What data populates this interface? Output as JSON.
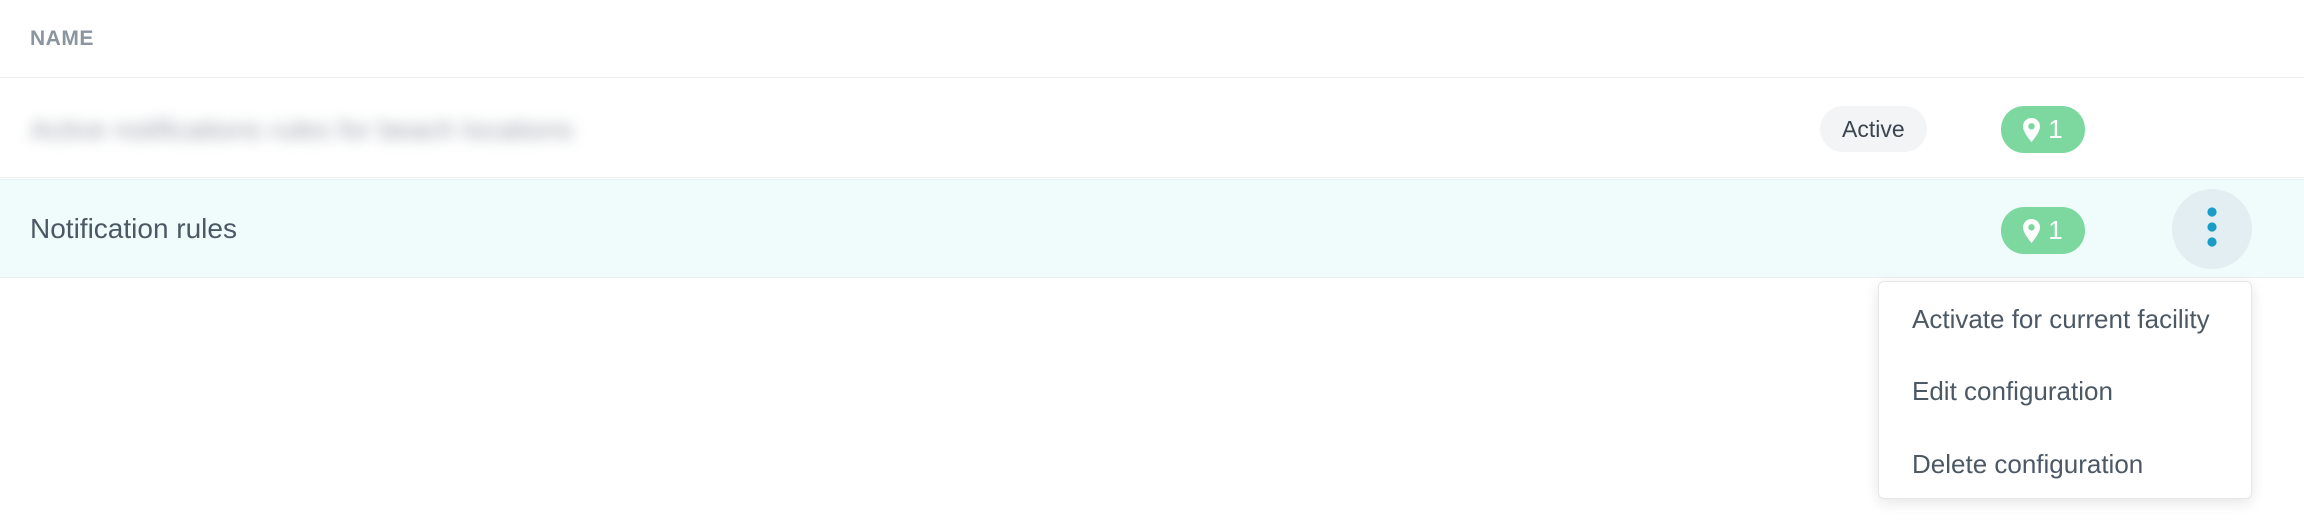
{
  "table": {
    "columns": {
      "name": "NAME"
    }
  },
  "rows": [
    {
      "name": "Active notifications rules for beach locations",
      "status": "Active",
      "facility_count": "1"
    },
    {
      "name": "Notification rules",
      "facility_count": "1"
    }
  ],
  "menu": {
    "items": [
      {
        "label": "Activate for current facility"
      },
      {
        "label": "Edit configuration"
      },
      {
        "label": "Delete configuration"
      }
    ]
  },
  "icons": {
    "facility": "map-pin-icon",
    "more": "vertical-dots-icon"
  },
  "colors": {
    "facility_badge": "#7dd8a0",
    "selected_row": "#f0fbfc",
    "more_dots": "#1a9cc8",
    "status_badge": "#f3f4f5"
  }
}
